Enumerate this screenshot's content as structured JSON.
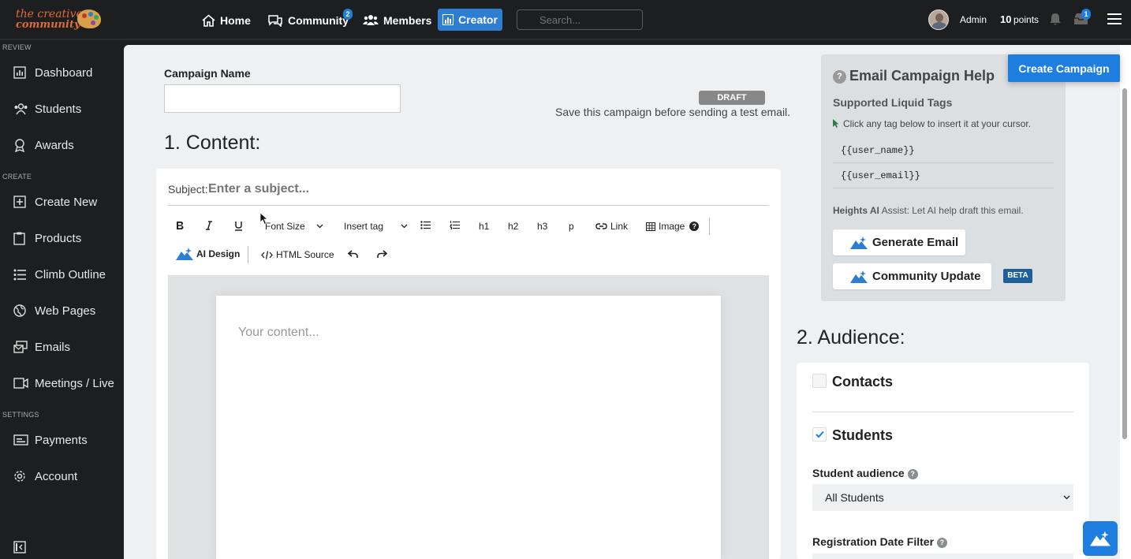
{
  "brand": {
    "line1": "the creative",
    "line2": "community"
  },
  "topnav": {
    "home": "Home",
    "community": "Community",
    "community_badge": "2",
    "members": "Members",
    "creator": "Creator",
    "search_placeholder": "Search...",
    "user": "Admin",
    "points_value": "10",
    "points_label": "points",
    "inbox_badge": "1"
  },
  "sidebar": {
    "sections": {
      "review": "REVIEW",
      "create": "CREATE",
      "settings": "SETTINGS"
    },
    "items": [
      "Dashboard",
      "Students",
      "Awards",
      "Create New",
      "Products",
      "Climb Outline",
      "Web Pages",
      "Emails",
      "Meetings / Live",
      "Payments",
      "Account"
    ]
  },
  "campaign": {
    "name_label": "Campaign Name",
    "status": "DRAFT",
    "hint": "Save this campaign before sending a test email.",
    "create_button": "Create Campaign"
  },
  "content": {
    "heading": "1. Content:",
    "subject_label": "Subject:",
    "subject_placeholder": "Enter a subject...",
    "body_placeholder": "Your content..."
  },
  "toolbar": {
    "font_size": "Font Size",
    "insert_tag": "Insert tag",
    "h1": "h1",
    "h2": "h2",
    "h3": "h3",
    "p": "p",
    "link": "Link",
    "image": "Image",
    "ai_design": "AI Design",
    "html_source": "HTML Source"
  },
  "help": {
    "title": "Email Campaign Help",
    "subtitle": "Supported Liquid Tags",
    "instruction": "Click any tag below to insert it at your cursor.",
    "tags": [
      "{{user_name}}",
      "{{user_email}}"
    ],
    "ai_label": "Heights AI",
    "ai_text": " Assist: Let AI help draft this email.",
    "generate": "Generate Email",
    "community_update": "Community Update",
    "beta": "BETA"
  },
  "audience": {
    "heading": "2. Audience:",
    "contacts": "Contacts",
    "students": "Students",
    "student_audience_label": "Student audience",
    "student_audience_value": "All Students",
    "registration_label": "Registration Date Filter"
  },
  "colors": {
    "accent": "#1d7ee0",
    "sidebar_bg": "#1d1e20",
    "draft_bg": "#888888",
    "beta_bg": "#1f5f99"
  }
}
